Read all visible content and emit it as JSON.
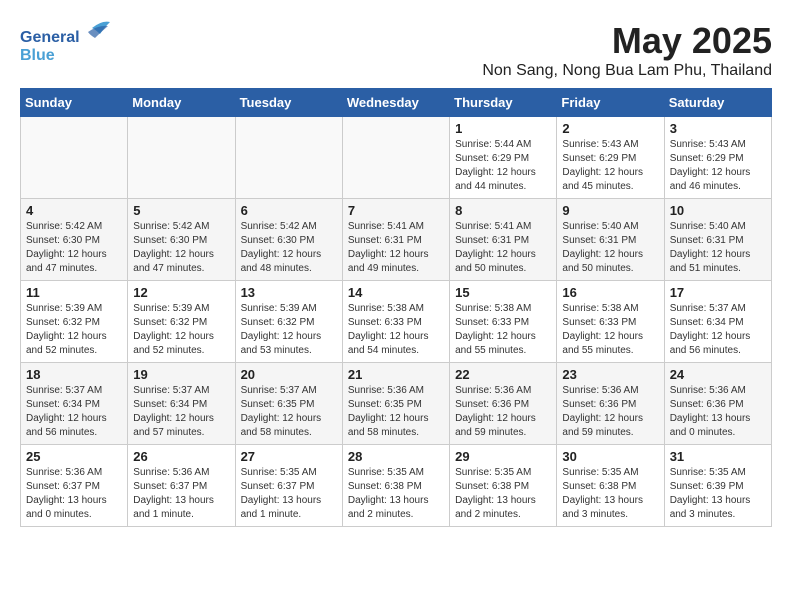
{
  "header": {
    "logo_line1": "General",
    "logo_line2": "Blue",
    "main_title": "May 2025",
    "sub_title": "Non Sang, Nong Bua Lam Phu, Thailand"
  },
  "weekdays": [
    "Sunday",
    "Monday",
    "Tuesday",
    "Wednesday",
    "Thursday",
    "Friday",
    "Saturday"
  ],
  "weeks": [
    [
      {
        "day": "",
        "info": ""
      },
      {
        "day": "",
        "info": ""
      },
      {
        "day": "",
        "info": ""
      },
      {
        "day": "",
        "info": ""
      },
      {
        "day": "1",
        "info": "Sunrise: 5:44 AM\nSunset: 6:29 PM\nDaylight: 12 hours\nand 44 minutes."
      },
      {
        "day": "2",
        "info": "Sunrise: 5:43 AM\nSunset: 6:29 PM\nDaylight: 12 hours\nand 45 minutes."
      },
      {
        "day": "3",
        "info": "Sunrise: 5:43 AM\nSunset: 6:29 PM\nDaylight: 12 hours\nand 46 minutes."
      }
    ],
    [
      {
        "day": "4",
        "info": "Sunrise: 5:42 AM\nSunset: 6:30 PM\nDaylight: 12 hours\nand 47 minutes."
      },
      {
        "day": "5",
        "info": "Sunrise: 5:42 AM\nSunset: 6:30 PM\nDaylight: 12 hours\nand 47 minutes."
      },
      {
        "day": "6",
        "info": "Sunrise: 5:42 AM\nSunset: 6:30 PM\nDaylight: 12 hours\nand 48 minutes."
      },
      {
        "day": "7",
        "info": "Sunrise: 5:41 AM\nSunset: 6:31 PM\nDaylight: 12 hours\nand 49 minutes."
      },
      {
        "day": "8",
        "info": "Sunrise: 5:41 AM\nSunset: 6:31 PM\nDaylight: 12 hours\nand 50 minutes."
      },
      {
        "day": "9",
        "info": "Sunrise: 5:40 AM\nSunset: 6:31 PM\nDaylight: 12 hours\nand 50 minutes."
      },
      {
        "day": "10",
        "info": "Sunrise: 5:40 AM\nSunset: 6:31 PM\nDaylight: 12 hours\nand 51 minutes."
      }
    ],
    [
      {
        "day": "11",
        "info": "Sunrise: 5:39 AM\nSunset: 6:32 PM\nDaylight: 12 hours\nand 52 minutes."
      },
      {
        "day": "12",
        "info": "Sunrise: 5:39 AM\nSunset: 6:32 PM\nDaylight: 12 hours\nand 52 minutes."
      },
      {
        "day": "13",
        "info": "Sunrise: 5:39 AM\nSunset: 6:32 PM\nDaylight: 12 hours\nand 53 minutes."
      },
      {
        "day": "14",
        "info": "Sunrise: 5:38 AM\nSunset: 6:33 PM\nDaylight: 12 hours\nand 54 minutes."
      },
      {
        "day": "15",
        "info": "Sunrise: 5:38 AM\nSunset: 6:33 PM\nDaylight: 12 hours\nand 55 minutes."
      },
      {
        "day": "16",
        "info": "Sunrise: 5:38 AM\nSunset: 6:33 PM\nDaylight: 12 hours\nand 55 minutes."
      },
      {
        "day": "17",
        "info": "Sunrise: 5:37 AM\nSunset: 6:34 PM\nDaylight: 12 hours\nand 56 minutes."
      }
    ],
    [
      {
        "day": "18",
        "info": "Sunrise: 5:37 AM\nSunset: 6:34 PM\nDaylight: 12 hours\nand 56 minutes."
      },
      {
        "day": "19",
        "info": "Sunrise: 5:37 AM\nSunset: 6:34 PM\nDaylight: 12 hours\nand 57 minutes."
      },
      {
        "day": "20",
        "info": "Sunrise: 5:37 AM\nSunset: 6:35 PM\nDaylight: 12 hours\nand 58 minutes."
      },
      {
        "day": "21",
        "info": "Sunrise: 5:36 AM\nSunset: 6:35 PM\nDaylight: 12 hours\nand 58 minutes."
      },
      {
        "day": "22",
        "info": "Sunrise: 5:36 AM\nSunset: 6:36 PM\nDaylight: 12 hours\nand 59 minutes."
      },
      {
        "day": "23",
        "info": "Sunrise: 5:36 AM\nSunset: 6:36 PM\nDaylight: 12 hours\nand 59 minutes."
      },
      {
        "day": "24",
        "info": "Sunrise: 5:36 AM\nSunset: 6:36 PM\nDaylight: 13 hours\nand 0 minutes."
      }
    ],
    [
      {
        "day": "25",
        "info": "Sunrise: 5:36 AM\nSunset: 6:37 PM\nDaylight: 13 hours\nand 0 minutes."
      },
      {
        "day": "26",
        "info": "Sunrise: 5:36 AM\nSunset: 6:37 PM\nDaylight: 13 hours\nand 1 minute."
      },
      {
        "day": "27",
        "info": "Sunrise: 5:35 AM\nSunset: 6:37 PM\nDaylight: 13 hours\nand 1 minute."
      },
      {
        "day": "28",
        "info": "Sunrise: 5:35 AM\nSunset: 6:38 PM\nDaylight: 13 hours\nand 2 minutes."
      },
      {
        "day": "29",
        "info": "Sunrise: 5:35 AM\nSunset: 6:38 PM\nDaylight: 13 hours\nand 2 minutes."
      },
      {
        "day": "30",
        "info": "Sunrise: 5:35 AM\nSunset: 6:38 PM\nDaylight: 13 hours\nand 3 minutes."
      },
      {
        "day": "31",
        "info": "Sunrise: 5:35 AM\nSunset: 6:39 PM\nDaylight: 13 hours\nand 3 minutes."
      }
    ]
  ]
}
